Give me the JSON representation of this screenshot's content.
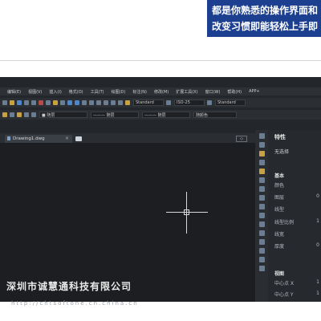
{
  "banner": {
    "line1": "都是你熟悉的操作界面和",
    "line2": "改变习惯即能轻松上手即"
  },
  "menubar": {
    "items": [
      "编辑(E)",
      "视图(V)",
      "插入(I)",
      "格式(O)",
      "工具(T)",
      "绘图(D)",
      "标注(N)",
      "修改(M)",
      "扩展工具(X)",
      "窗口(W)",
      "帮助(H)",
      "APP+"
    ]
  },
  "toolbar": {
    "text_style": "Standard",
    "dim_style": "ISO-25",
    "table_style": "Standard",
    "layer_color": "■ 随层",
    "linetype": "——— 随层",
    "lineweight": "——— 随层",
    "plot_style": "随颜色"
  },
  "tabs": {
    "active": "Drawing1.dwg",
    "close": "×"
  },
  "tabs_toggle": "◇",
  "properties": {
    "title": "特性",
    "selection": "无选择",
    "section_basic": "基本",
    "rows": [
      {
        "label": "颜色",
        "value": ""
      },
      {
        "label": "图层",
        "value": "0"
      },
      {
        "label": "线型",
        "value": ""
      },
      {
        "label": "线型比例",
        "value": "1"
      },
      {
        "label": "线宽",
        "value": ""
      },
      {
        "label": "厚度",
        "value": "0"
      }
    ],
    "section_view": "视图",
    "view_rows": [
      {
        "label": "中心点 X",
        "value": "1"
      },
      {
        "label": "中心点 Y",
        "value": "1"
      }
    ]
  },
  "watermark": {
    "company": "深圳市诚慧通科技有限公司",
    "url": "http://chtsoftone.cn.china.cn"
  }
}
